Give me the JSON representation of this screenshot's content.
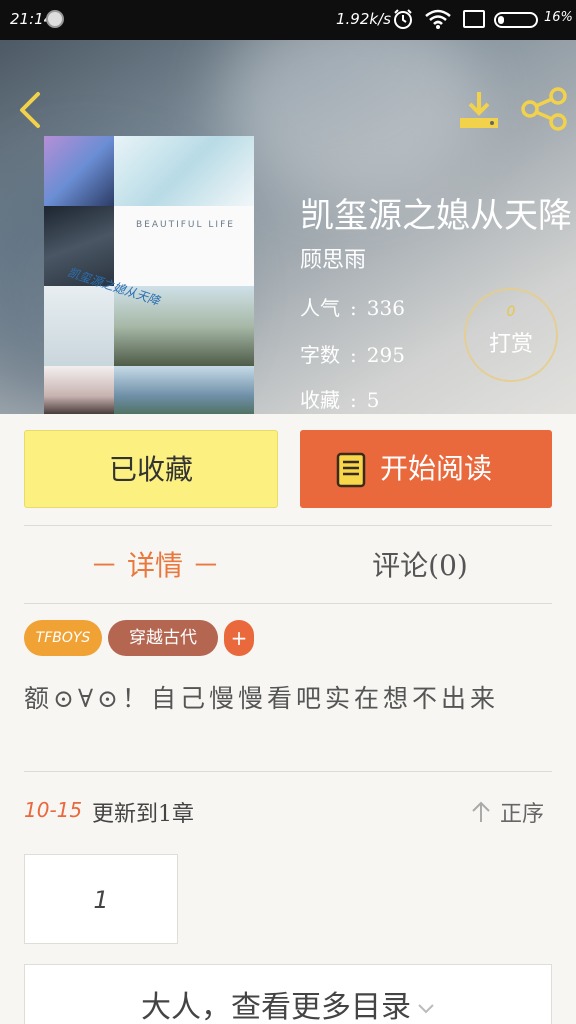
{
  "status_bar": {
    "time": "21:14",
    "speed": "1.92k/s",
    "battery": "16%",
    "battery_level": 0.16
  },
  "header": {
    "icons": {
      "back": "back-chevron-icon",
      "download": "download-icon",
      "share": "share-icon"
    }
  },
  "book": {
    "title": "凯玺源之媳从天降",
    "author": "顾思雨",
    "cover_text": "BEAUTIFUL LIFE",
    "cover_handwriting": "凯玺源之媳从天降",
    "stats": [
      {
        "label": "人气",
        "value": "336"
      },
      {
        "label": "字数",
        "value": "295"
      },
      {
        "label": "收藏",
        "value": "5"
      }
    ]
  },
  "tip": {
    "count": "0",
    "label": "打赏"
  },
  "actions": {
    "collected_label": "已收藏",
    "read_label": "开始阅读"
  },
  "tabs": {
    "details": "－ 详情 －",
    "comments": "评论(0)"
  },
  "tags": {
    "tfboys": "TFBOYS",
    "time_travel": "穿越古代",
    "add": "+"
  },
  "description": "额⊙∀⊙！自己慢慢看吧实在想不出来",
  "update": {
    "date": "10-15",
    "text": "更新到1章",
    "sort_label": "正序"
  },
  "chapters": [
    "1"
  ],
  "more_label": "大人，查看更多目录",
  "colors": {
    "accent_orange": "#e9683c",
    "collected_yellow": "#fbf080",
    "tag_tfboys": "#f0a234",
    "tag_time_travel": "#b46651"
  }
}
